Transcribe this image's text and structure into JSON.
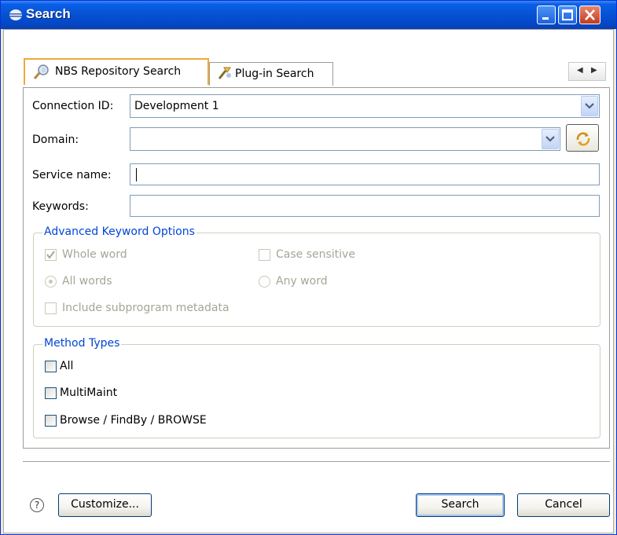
{
  "window": {
    "title": "Search",
    "title_icon": "eclipse-icon",
    "controls": [
      "minimize",
      "maximize",
      "close"
    ]
  },
  "tabs": [
    {
      "label": "NBS Repository Search",
      "icon": "repository-search-icon",
      "active": true
    },
    {
      "label": "Plug-in Search",
      "icon": "plugin-search-icon",
      "active": false
    }
  ],
  "form": {
    "connection_label": "Connection ID:",
    "connection_value": "Development 1",
    "domain_label": "Domain:",
    "domain_value": "",
    "service_label": "Service name:",
    "service_value": "",
    "keywords_label": "Keywords:",
    "keywords_value": ""
  },
  "advanced": {
    "legend": "Advanced Keyword Options",
    "whole_word": {
      "label": "Whole word",
      "checked": true,
      "enabled": false
    },
    "case_sensitive": {
      "label": "Case sensitive",
      "checked": false,
      "enabled": false
    },
    "all_words": {
      "label": "All words",
      "selected": true,
      "enabled": false
    },
    "any_word": {
      "label": "Any word",
      "selected": false,
      "enabled": false
    },
    "include_subprogram": {
      "label": "Include subprogram metadata",
      "checked": false,
      "enabled": false
    }
  },
  "method_types": {
    "legend": "Method Types",
    "items": [
      {
        "label": "All",
        "checked": false
      },
      {
        "label": "MultiMaint",
        "checked": false
      },
      {
        "label": "Browse / FindBy / BROWSE",
        "checked": false
      }
    ]
  },
  "footer": {
    "help_symbol": "?",
    "customize_label": "Customize...",
    "search_label": "Search",
    "cancel_label": "Cancel"
  },
  "colors": {
    "titlebar": "#0753d4",
    "active_tab_accent": "#f0a83a",
    "group_legend": "#0046d5",
    "disabled_text": "#a5a597"
  }
}
